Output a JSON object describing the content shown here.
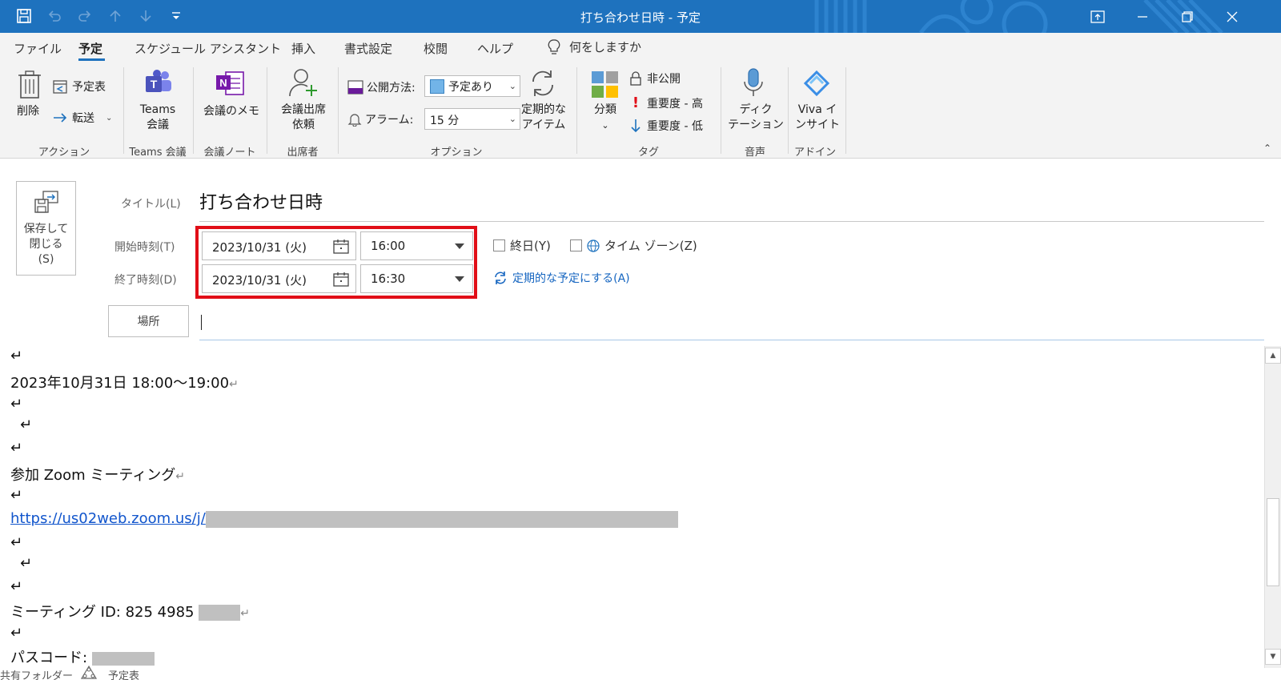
{
  "window": {
    "title": "打ち合わせ日時 - 予定",
    "accent": "#1e72be"
  },
  "quick_access": [
    "save-icon",
    "undo-icon",
    "redo-icon",
    "up-arrow-icon",
    "down-arrow-icon",
    "customize-icon"
  ],
  "tabs": [
    {
      "label": "ファイル"
    },
    {
      "label": "予定"
    },
    {
      "label": "スケジュール アシスタント"
    },
    {
      "label": "挿入"
    },
    {
      "label": "書式設定"
    },
    {
      "label": "校閲"
    },
    {
      "label": "ヘルプ"
    }
  ],
  "tell_me": "何をしますか",
  "ribbon": {
    "actions": {
      "delete": "削除",
      "calendar": "予定表",
      "forward": "転送",
      "label": "アクション"
    },
    "teams": {
      "line1": "Teams",
      "line2": "会議",
      "label": "Teams 会議"
    },
    "notes": {
      "button": "会議のメモ",
      "label": "会議ノート"
    },
    "attendees": {
      "line1": "会議出席",
      "line2": "依頼",
      "label": "出席者"
    },
    "options": {
      "show_as_label": "公開方法:",
      "show_as_value": "予定あり",
      "alarm_label": "アラーム:",
      "alarm_value": "15 分",
      "recurring_line1": "定期的な",
      "recurring_line2": "アイテム",
      "label": "オプション"
    },
    "tags": {
      "categorize": "分類",
      "private": "非公開",
      "high": "重要度 - 高",
      "low": "重要度 - 低",
      "label": "タグ"
    },
    "voice": {
      "line1": "ディク",
      "line2": "テーション",
      "label": "音声"
    },
    "addins": {
      "line1": "Viva イ",
      "line2": "ンサイト",
      "label": "アドイン"
    }
  },
  "form": {
    "save_close": {
      "line1": "保存して",
      "line2": "閉じる",
      "line3": "(S)"
    },
    "title_label": "タイトル(L)",
    "title_value": "打ち合わせ日時",
    "start_label": "開始時刻(T)",
    "end_label": "終了時刻(D)",
    "start_date": "2023/10/31 (火)",
    "start_time": "16:00",
    "end_date": "2023/10/31 (火)",
    "end_time": "16:30",
    "all_day": "終日(Y)",
    "time_zone": "タイム ゾーン(Z)",
    "make_recurring": "定期的な予定にする(A)",
    "location_button": "場所",
    "location_value": ""
  },
  "body": {
    "paragraph_mark": "↵",
    "date_line": "2023年10月31日  18:00〜19:00",
    "zoom_join": "参加  Zoom  ミーティング",
    "zoom_url": "https://us02web.zoom.us/j/",
    "meeting_id": "ミーティング  ID: 825 4985 ",
    "passcode": "パスコード: "
  },
  "status": {
    "shared_folder": "共有フォルダー",
    "calendar": "予定表"
  }
}
